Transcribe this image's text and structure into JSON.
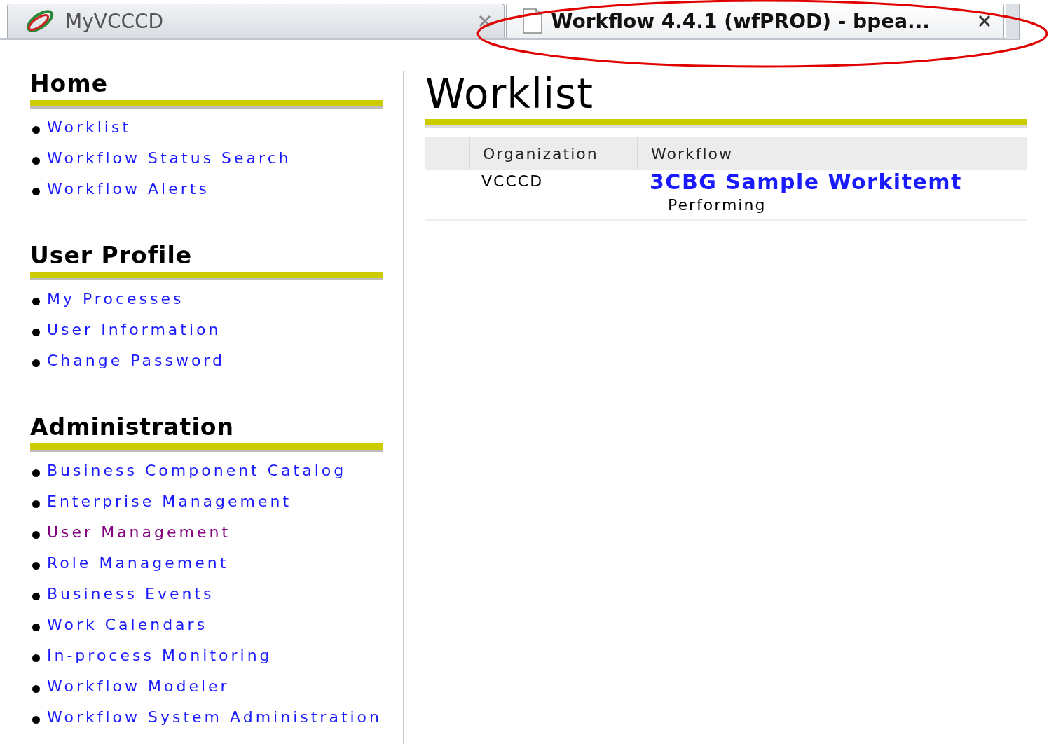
{
  "tabs": [
    {
      "kind": "logo",
      "title": "MyVCCCD",
      "selected": false
    },
    {
      "kind": "page",
      "title": "Workflow 4.4.1 (wfPROD) - bpea...",
      "selected": true
    }
  ],
  "sidebar": {
    "sections": [
      {
        "heading": "Home",
        "items": [
          {
            "label": "Worklist",
            "visited": false
          },
          {
            "label": "Workflow Status Search",
            "visited": false
          },
          {
            "label": "Workflow Alerts",
            "visited": false
          }
        ]
      },
      {
        "heading": "User Profile",
        "items": [
          {
            "label": "My Processes",
            "visited": false
          },
          {
            "label": "User Information",
            "visited": false
          },
          {
            "label": "Change Password",
            "visited": false
          }
        ]
      },
      {
        "heading": "Administration",
        "items": [
          {
            "label": "Business Component Catalog",
            "visited": false
          },
          {
            "label": "Enterprise Management",
            "visited": false
          },
          {
            "label": "User Management",
            "visited": true
          },
          {
            "label": "Role Management",
            "visited": false
          },
          {
            "label": "Business Events",
            "visited": false
          },
          {
            "label": "Work Calendars",
            "visited": false
          },
          {
            "label": "In-process Monitoring",
            "visited": false
          },
          {
            "label": "Workflow Modeler",
            "visited": false
          },
          {
            "label": "Workflow System Administration",
            "visited": false
          }
        ]
      }
    ]
  },
  "main": {
    "title": "Worklist",
    "table": {
      "columns": [
        "Organization",
        "Workflow"
      ],
      "rows": [
        {
          "organization": "VCCCD",
          "workflow": "3CBG Sample Workitemt",
          "status": "Performing"
        }
      ]
    }
  }
}
